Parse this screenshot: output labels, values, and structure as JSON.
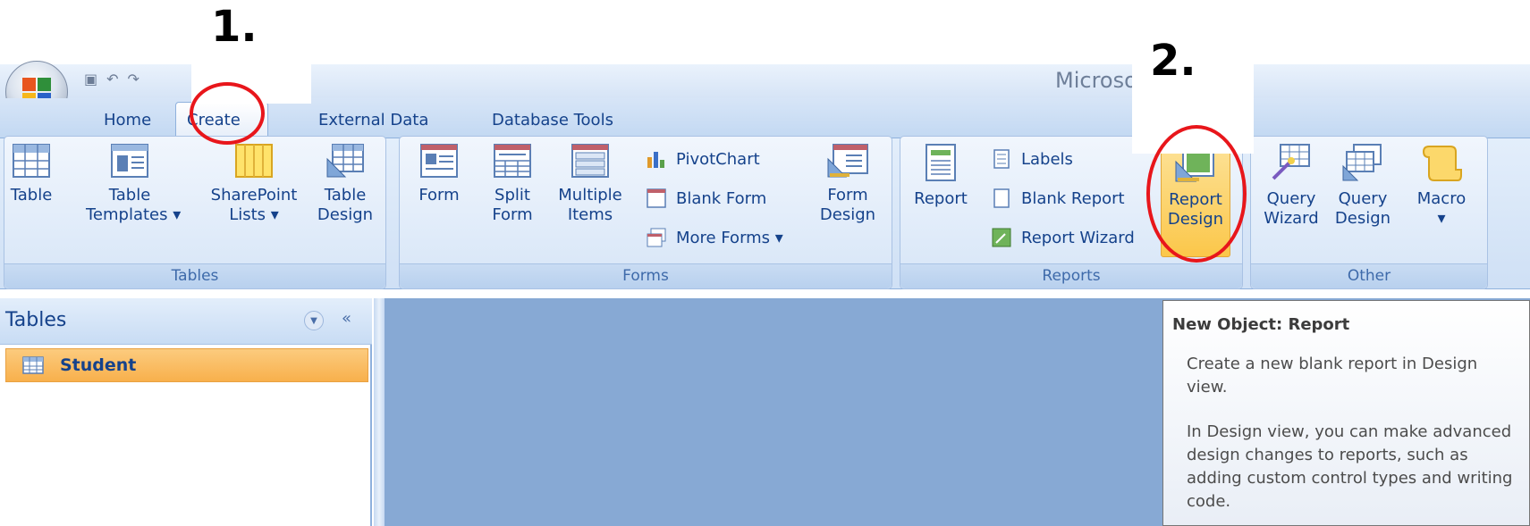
{
  "window": {
    "title": "Microso"
  },
  "tabs": [
    {
      "label": "Home"
    },
    {
      "label": "Create"
    },
    {
      "label": "External Data"
    },
    {
      "label": "Database Tools"
    }
  ],
  "ribbon": {
    "tables": {
      "label": "Tables",
      "buttons": [
        "Table",
        "Table\nTemplates ▾",
        "SharePoint\nLists ▾",
        "Table\nDesign"
      ]
    },
    "forms": {
      "label": "Forms",
      "buttons": [
        "Form",
        "Split\nForm",
        "Multiple\nItems",
        "Form\nDesign"
      ],
      "small": [
        "PivotChart",
        "Blank Form",
        "More Forms ▾"
      ]
    },
    "reports": {
      "label": "Reports",
      "buttons": [
        "Report",
        "Report\nDesign"
      ],
      "small": [
        "Labels",
        "Blank Report",
        "Report Wizard"
      ]
    },
    "other": {
      "label": "Other",
      "buttons": [
        "Query\nWizard",
        "Query\nDesign",
        "Macro\n▾"
      ]
    }
  },
  "nav": {
    "title": "Tables",
    "collapse": "«",
    "menu": "▼",
    "items": [
      {
        "label": "Student"
      }
    ]
  },
  "tooltip": {
    "title": "New Object: Report",
    "p1": "Create a new blank report in Design view.",
    "p2": "In Design view, you can make advanced design changes to reports, such as adding custom control types and writing code."
  },
  "annotations": {
    "step1": "1.",
    "step2": "2."
  },
  "colors": {
    "annotation_circle": "#e8161b",
    "selected_nav": "#f8b04c",
    "workspace": "#87a9d4"
  }
}
